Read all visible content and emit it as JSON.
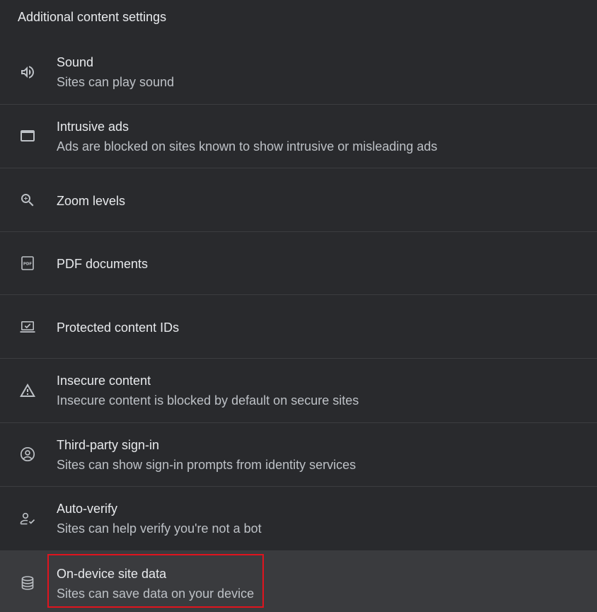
{
  "section": {
    "title": "Additional content settings"
  },
  "items": [
    {
      "title": "Sound",
      "subtitle": "Sites can play sound",
      "icon": "speaker-icon"
    },
    {
      "title": "Intrusive ads",
      "subtitle": "Ads are blocked on sites known to show intrusive or misleading ads",
      "icon": "window-icon"
    },
    {
      "title": "Zoom levels",
      "subtitle": "",
      "icon": "zoom-in-icon"
    },
    {
      "title": "PDF documents",
      "subtitle": "",
      "icon": "pdf-icon"
    },
    {
      "title": "Protected content IDs",
      "subtitle": "",
      "icon": "laptop-check-icon"
    },
    {
      "title": "Insecure content",
      "subtitle": "Insecure content is blocked by default on secure sites",
      "icon": "warning-icon"
    },
    {
      "title": "Third-party sign-in",
      "subtitle": "Sites can show sign-in prompts from identity services",
      "icon": "account-circle-icon"
    },
    {
      "title": "Auto-verify",
      "subtitle": "Sites can help verify you're not a bot",
      "icon": "person-check-icon"
    },
    {
      "title": "On-device site data",
      "subtitle": "Sites can save data on your device",
      "icon": "database-icon"
    }
  ],
  "colors": {
    "background": "#292a2d",
    "active_row": "#3a3b3e",
    "divider": "#3c3d40",
    "text_primary": "#e8eaed",
    "text_secondary": "#bdc1c6",
    "highlight": "#e0141e"
  }
}
